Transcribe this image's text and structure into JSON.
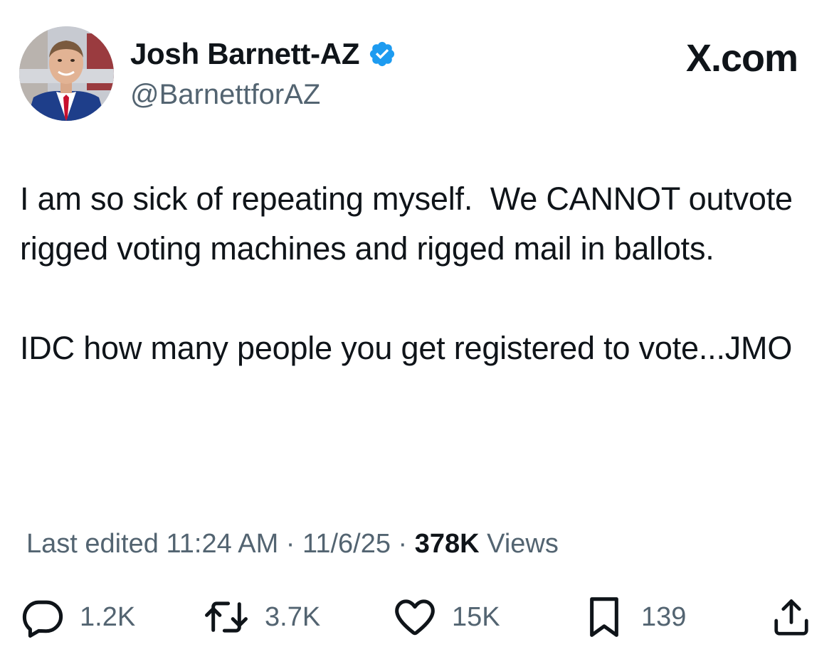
{
  "author": {
    "display_name": "Josh Barnett-AZ",
    "handle": "@BarnettforAZ",
    "verified": true,
    "verified_color": "#1d9bf0"
  },
  "brand": "X.com",
  "tweet": {
    "text": "I am so sick of repeating myself.  We CANNOT outvote rigged voting machines and rigged mail in ballots.\n\nIDC how many people you get registered to vote...JMO"
  },
  "meta": {
    "edited_label": "Last edited",
    "time": "11:24 AM",
    "date": "11/6/25",
    "views_count": "378K",
    "views_label": "Views",
    "separator": "·"
  },
  "actions": {
    "reply": {
      "icon": "reply-icon",
      "count": "1.2K"
    },
    "repost": {
      "icon": "repost-icon",
      "count": "3.7K"
    },
    "like": {
      "icon": "heart-icon",
      "count": "15K"
    },
    "bookmark": {
      "icon": "bookmark-icon",
      "count": "139"
    },
    "share": {
      "icon": "share-icon"
    }
  },
  "colors": {
    "text_primary": "#0f1419",
    "text_secondary": "#536471",
    "accent": "#1d9bf0"
  }
}
